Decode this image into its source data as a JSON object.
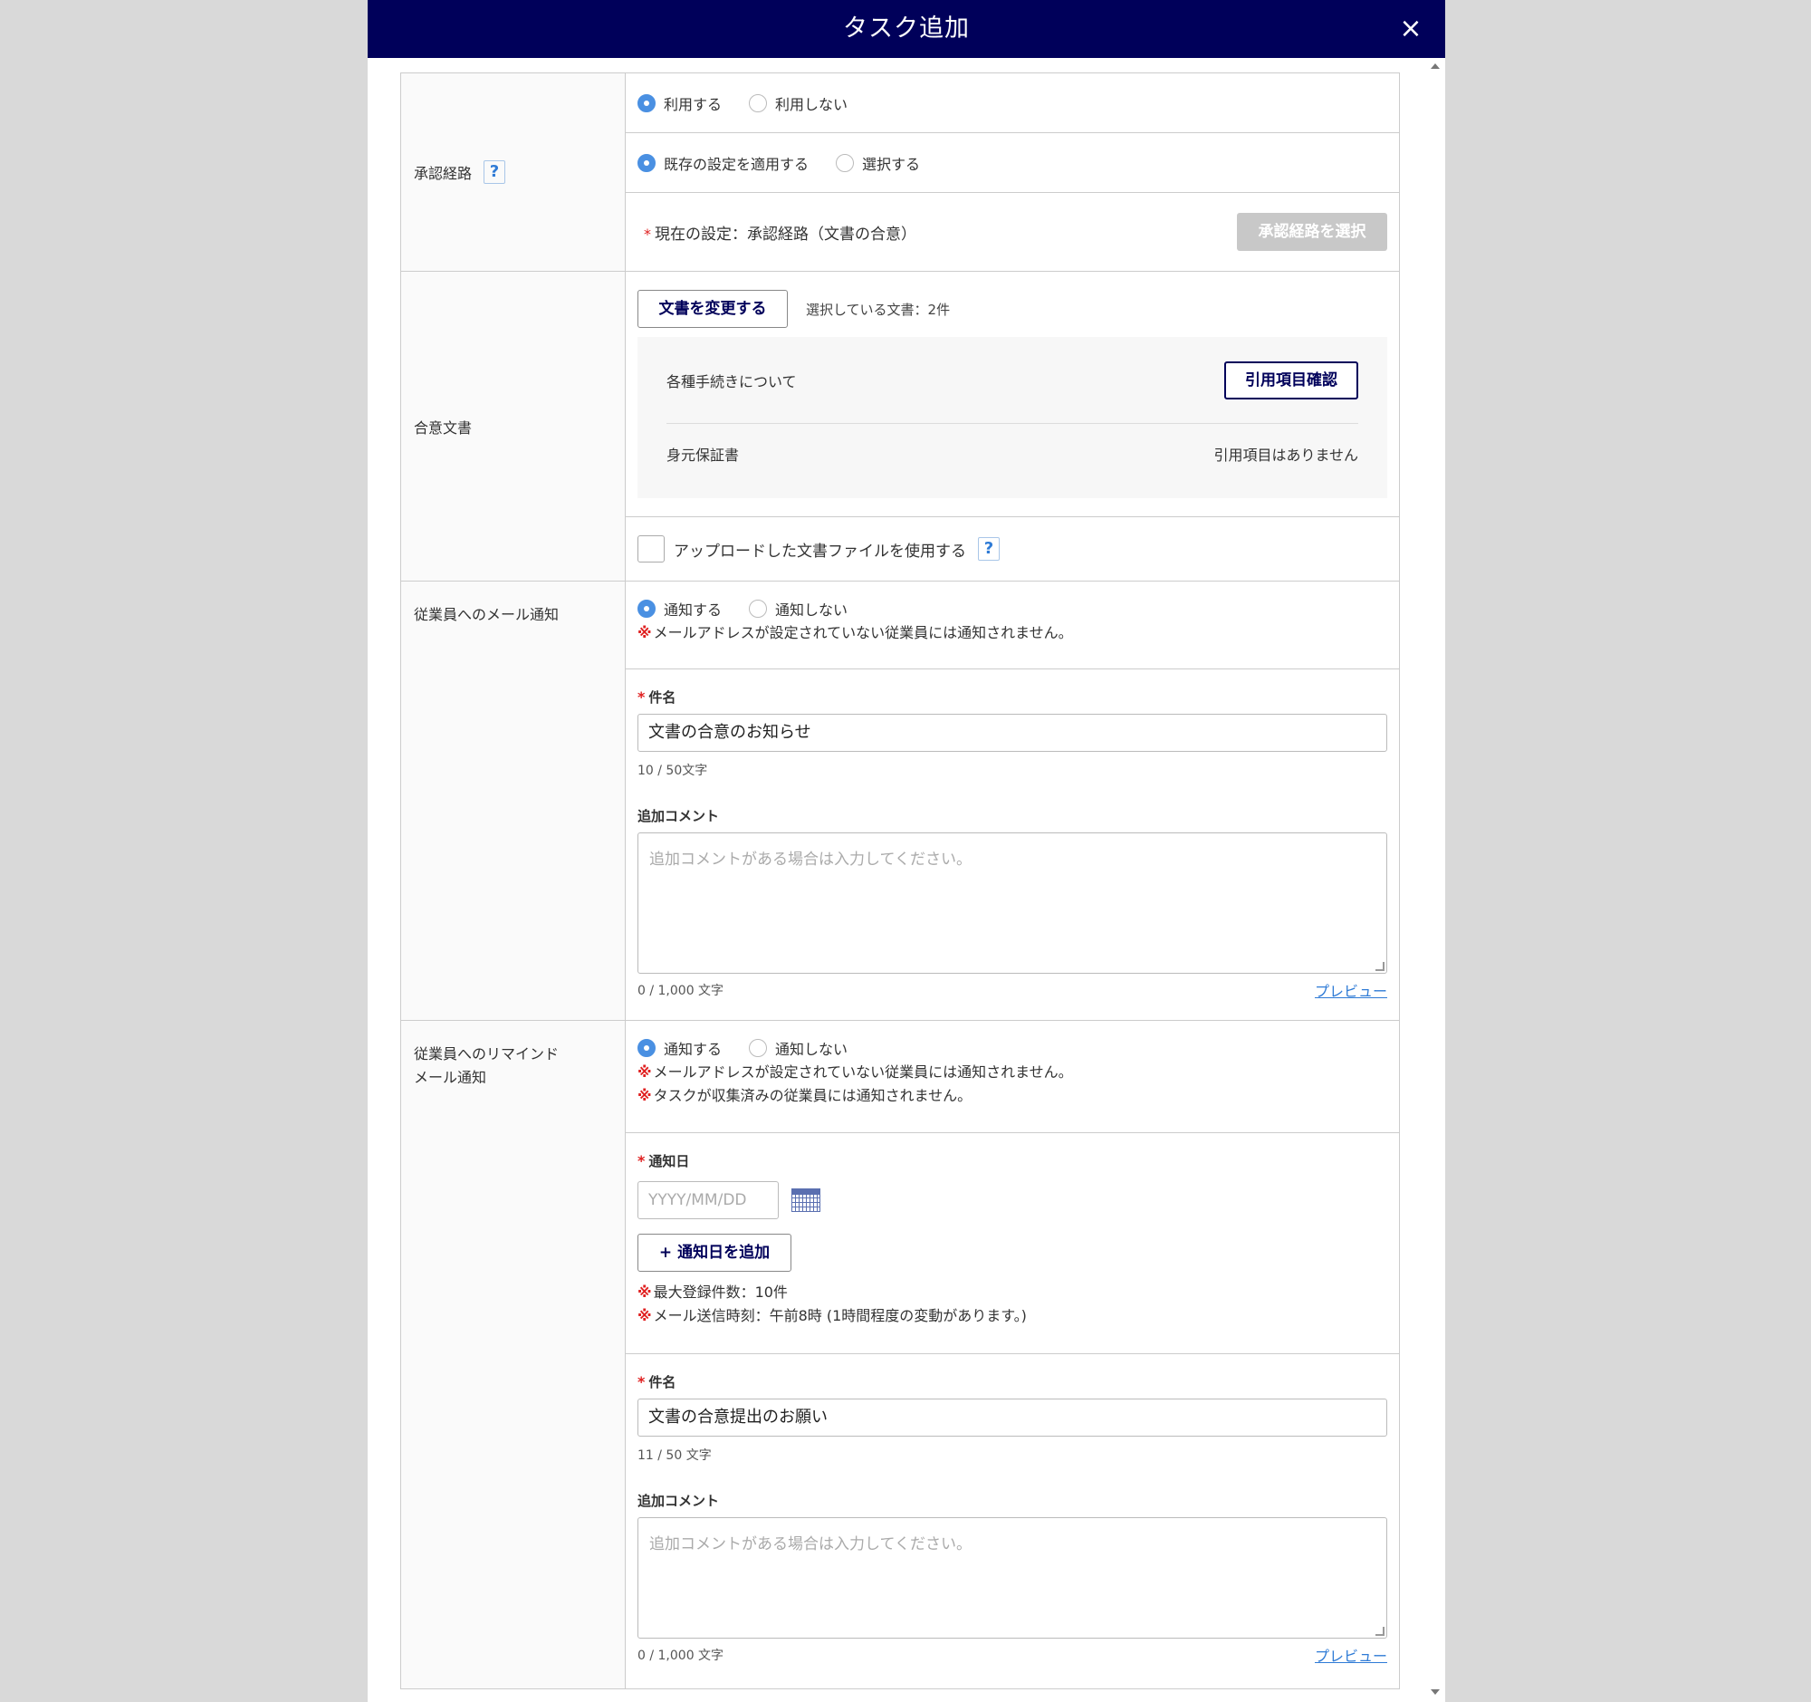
{
  "modal": {
    "title": "タスク追加"
  },
  "approval": {
    "label": "承認経路",
    "use_options": [
      "利用する",
      "利用しない"
    ],
    "setting_options": [
      "既存の設定を適用する",
      "選択する"
    ],
    "current_setting": "現在の設定：承認経路（文書の合意）",
    "select_button": "承認経路を選択"
  },
  "agreement": {
    "label": "合意文書",
    "change_button": "文書を変更する",
    "selected_count": "選択している文書：2件",
    "documents": [
      {
        "name": "各種手続きについて",
        "action": "引用項目確認"
      },
      {
        "name": "身元保証書",
        "status": "引用項目はありません"
      }
    ],
    "upload_label": "アップロードした文書ファイルを使用する"
  },
  "mail": {
    "label": "従業員へのメール通知",
    "options": [
      "通知する",
      "通知しない"
    ],
    "note": "メールアドレスが設定されていない従業員には通知されません。",
    "subject_label": "件名",
    "subject_value": "文書の合意のお知らせ",
    "subject_count": "10 / 50文字",
    "comment_label": "追加コメント",
    "comment_placeholder": "追加コメントがある場合は入力してください。",
    "comment_count": "0 / 1,000 文字",
    "preview": "プレビュー"
  },
  "remind": {
    "label_line1": "従業員へのリマインド",
    "label_line2": "メール通知",
    "options": [
      "通知する",
      "通知しない"
    ],
    "note1": "メールアドレスが設定されていない従業員には通知されません。",
    "note2": "タスクが収集済みの従業員には通知されません。",
    "date_label": "通知日",
    "date_placeholder": "YYYY/MM/DD",
    "add_date_button": "通知日を追加",
    "limit_note1": "最大登録件数：10件",
    "limit_note2": "メール送信時刻：午前8時 (1時間程度の変動があります。)",
    "subject_label": "件名",
    "subject_value": "文書の合意提出のお願い",
    "subject_count": "11 / 50 文字",
    "comment_label": "追加コメント",
    "comment_placeholder": "追加コメントがある場合は入力してください。",
    "comment_count": "0 / 1,000 文字",
    "preview": "プレビュー"
  },
  "marks": {
    "required": "*",
    "note": "※",
    "plus": "+",
    "help": "?",
    "close": "×"
  }
}
